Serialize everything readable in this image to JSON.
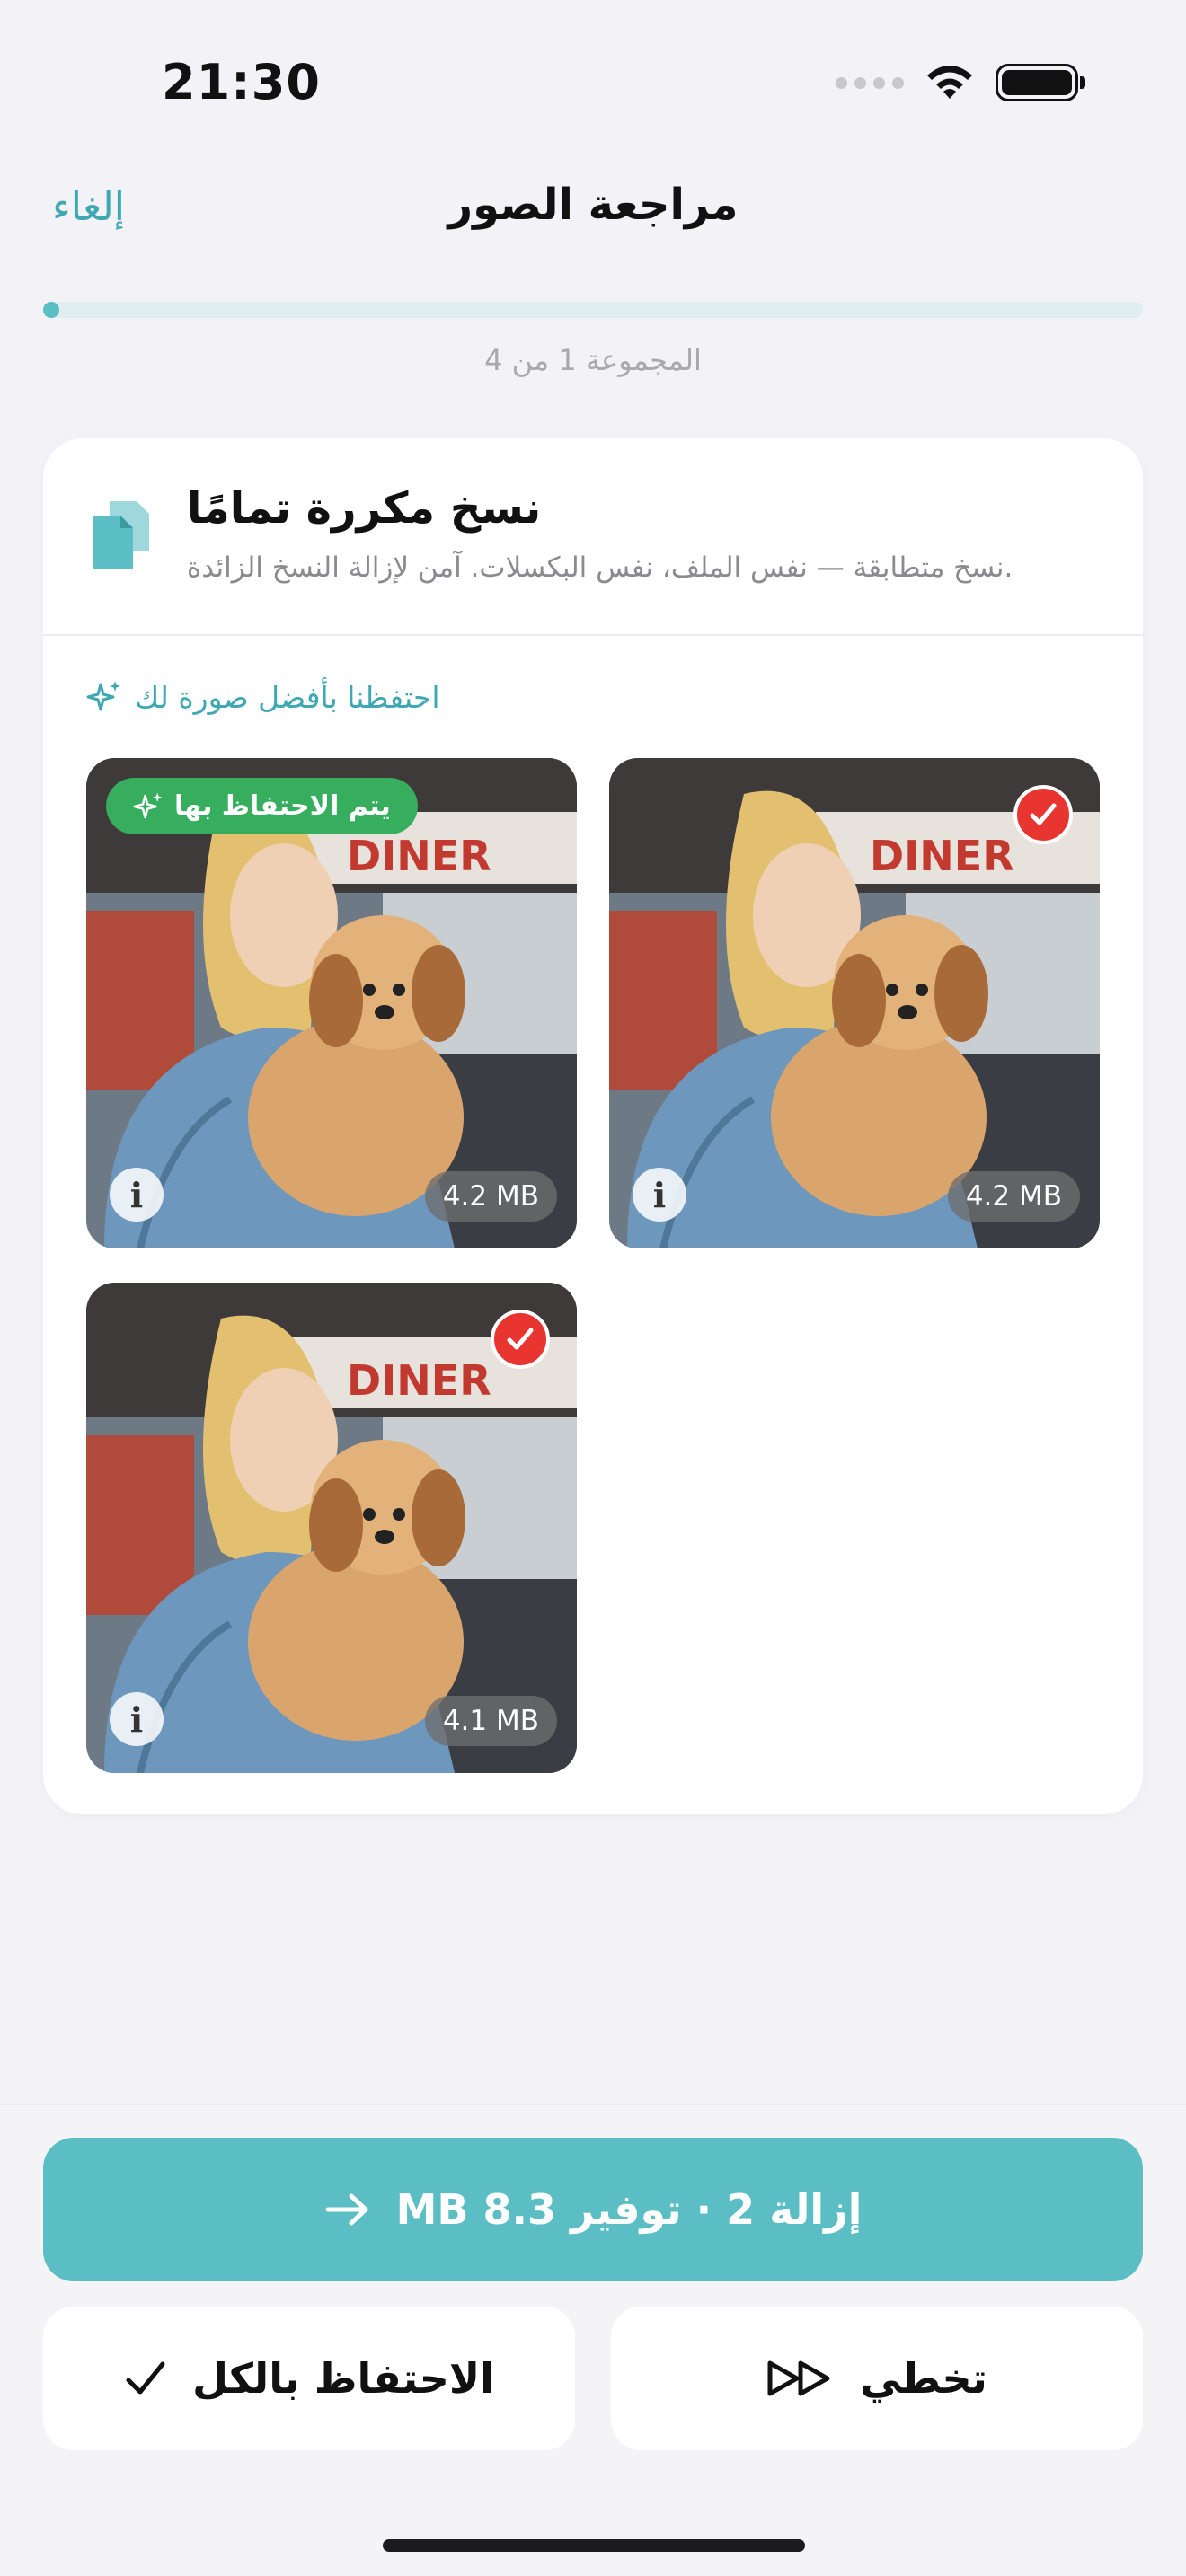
{
  "status_bar": {
    "time": "21:30"
  },
  "nav": {
    "cancel": "إلغاء",
    "title": "مراجعة الصور"
  },
  "progress": {
    "fraction": 0.01,
    "label": "المجموعة 1 من 4"
  },
  "group": {
    "title": "نسخ مكررة تمامًا",
    "subtitle": "نسخ متطابقة — نفس الملف، نفس البكسلات. آمن لإزالة النسخ الزائدة.",
    "note": "احتفظنا بأفضل صورة لك",
    "photos": [
      {
        "size": "4.2 MB",
        "keep_label": "يتم الاحتفاظ بها",
        "kept": true
      },
      {
        "size": "4.2 MB",
        "kept": false
      },
      {
        "size": "4.1 MB",
        "kept": false
      }
    ]
  },
  "actions": {
    "remove": "إزالة 2 · توفير 8.3 MB",
    "keep_all": "الاحتفاظ بالكل",
    "skip": "تخطي"
  },
  "colors": {
    "accent": "#5bbec4",
    "keep": "#36ae5d",
    "remove_mark": "#e8352f"
  }
}
